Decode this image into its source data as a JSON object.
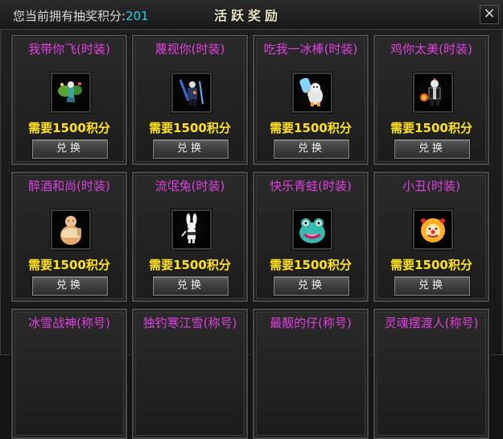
{
  "header": {
    "points_label": "您当前拥有抽奖积分:",
    "points_value": "201",
    "title": "活跃奖励",
    "close_symbol": "×"
  },
  "rewards": [
    {
      "name": "我带你飞(时装)",
      "cost": "需要1500积分",
      "button": "兑换",
      "icon": "flying-fashion-icon"
    },
    {
      "name": "蔑视你(时装)",
      "cost": "需要1500积分",
      "button": "兑换",
      "icon": "armored-fashion-icon"
    },
    {
      "name": "吃我一冰棒(时装)",
      "cost": "需要1500积分",
      "button": "兑换",
      "icon": "ice-popsicle-fashion-icon"
    },
    {
      "name": "鸡你太美(时装)",
      "cost": "需要1500积分",
      "button": "兑换",
      "icon": "chicken-fashion-icon"
    },
    {
      "name": "醉酒和尚(时装)",
      "cost": "需要1500积分",
      "button": "兑换",
      "icon": "drunk-monk-fashion-icon"
    },
    {
      "name": "流氓兔(时装)",
      "cost": "需要1500积分",
      "button": "兑换",
      "icon": "rogue-rabbit-fashion-icon"
    },
    {
      "name": "快乐青蛙(时装)",
      "cost": "需要1500积分",
      "button": "兑换",
      "icon": "happy-frog-fashion-icon"
    },
    {
      "name": "小丑(时装)",
      "cost": "需要1500积分",
      "button": "兑换",
      "icon": "clown-fashion-icon"
    },
    {
      "name": "冰雪战神(称号)",
      "icon": ""
    },
    {
      "name": "独钓寒江雪(称号)",
      "icon": ""
    },
    {
      "name": "最靓的仔(称号)",
      "icon": ""
    },
    {
      "name": "灵魂摆渡人(称号)",
      "icon": ""
    }
  ]
}
